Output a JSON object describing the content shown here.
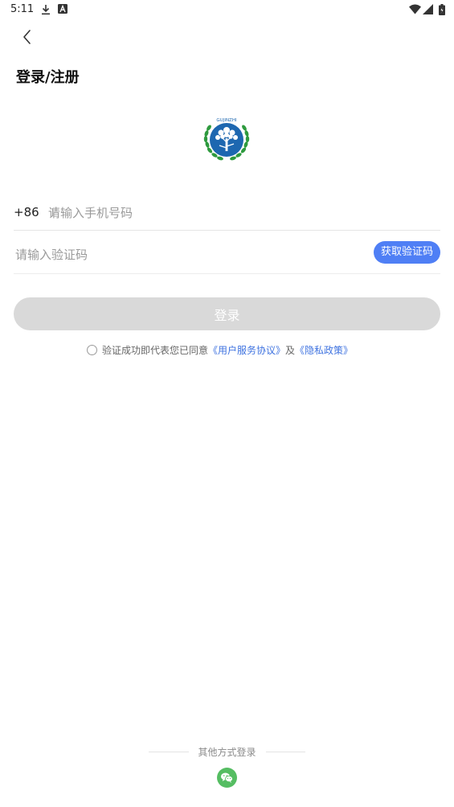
{
  "status_bar": {
    "time": "5:11",
    "icons": [
      "download-icon",
      "a-notification-icon",
      "wifi-icon",
      "signal-icon",
      "battery-icon"
    ]
  },
  "header": {
    "back_icon": "chevron-left-icon",
    "title": "登录/注册"
  },
  "logo": {
    "brand_text": "GUJINZHI",
    "colors": {
      "blue": "#1d67b0",
      "green": "#2e9a3e"
    }
  },
  "phone": {
    "country_code": "+86",
    "placeholder": "请输入手机号码",
    "value": ""
  },
  "verification": {
    "placeholder": "请输入验证码",
    "value": "",
    "get_code_label": "获取验证码",
    "button_color": "#4f7ff5"
  },
  "login_button": {
    "label": "登录",
    "disabled_color": "#d9d9d9"
  },
  "agreement": {
    "checked": false,
    "prefix": "验证成功即代表您已同意",
    "terms_link": "《用户服务协议》",
    "joiner": "及",
    "privacy_link": "《隐私政策》",
    "link_color": "#3f73e0"
  },
  "other_login": {
    "label": "其他方式登录",
    "wechat_icon": "wechat-icon",
    "wechat_color": "#55bd62"
  }
}
